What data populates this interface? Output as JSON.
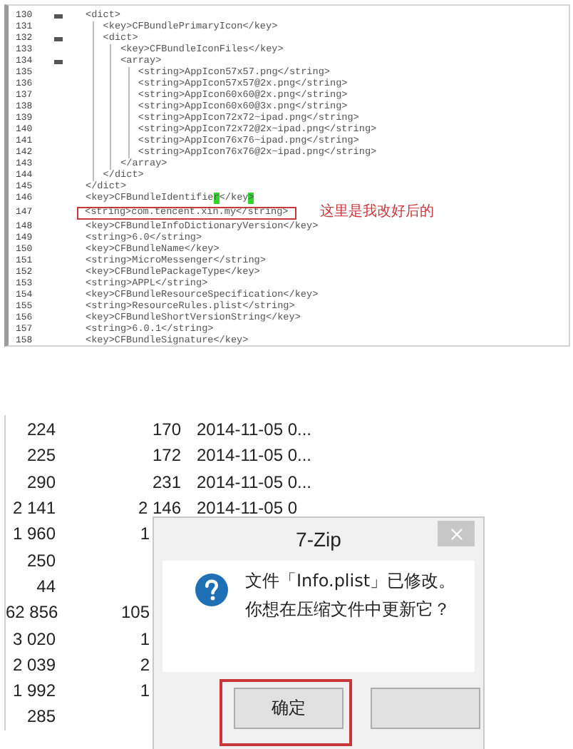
{
  "editor": {
    "lines": [
      {
        "number": "130",
        "fold": true,
        "code": "<dict>"
      },
      {
        "number": "131",
        "fold": false,
        "code": "   <key>CFBundlePrimaryIcon</key>"
      },
      {
        "number": "132",
        "fold": true,
        "code": "   <dict>"
      },
      {
        "number": "133",
        "fold": false,
        "code": "      <key>CFBundleIconFiles</key>"
      },
      {
        "number": "134",
        "fold": true,
        "code": "      <array>"
      },
      {
        "number": "135",
        "fold": false,
        "code": "         <string>AppIcon57x57.png</string>"
      },
      {
        "number": "136",
        "fold": false,
        "code": "         <string>AppIcon57x57@2x.png</string>"
      },
      {
        "number": "137",
        "fold": false,
        "code": "         <string>AppIcon60x60@2x.png</string>"
      },
      {
        "number": "138",
        "fold": false,
        "code": "         <string>AppIcon60x60@3x.png</string>"
      },
      {
        "number": "139",
        "fold": false,
        "code": "         <string>AppIcon72x72~ipad.png</string>"
      },
      {
        "number": "140",
        "fold": false,
        "code": "         <string>AppIcon72x72@2x~ipad.png</string>"
      },
      {
        "number": "141",
        "fold": false,
        "code": "         <string>AppIcon76x76~ipad.png</string>"
      },
      {
        "number": "142",
        "fold": false,
        "code": "         <string>AppIcon76x76@2x~ipad.png</string>"
      },
      {
        "number": "143",
        "fold": false,
        "code": "      </array>"
      },
      {
        "number": "144",
        "fold": false,
        "code": "   </dict>"
      },
      {
        "number": "145",
        "fold": false,
        "code": "</dict>"
      },
      {
        "number": "146",
        "fold": false,
        "parts": [
          {
            "text": "<key>CFBundleIdentifie",
            "match": false
          },
          {
            "text": "r",
            "match": true
          },
          {
            "text": "</key",
            "match": false
          },
          {
            "text": ">",
            "match": true
          }
        ]
      },
      {
        "number": "147",
        "fold": false,
        "code": "<string>com.tencent.xin.my</string>",
        "boxed": true,
        "note": "这里是我改好后的"
      },
      {
        "number": "148",
        "fold": false,
        "code": "<key>CFBundleInfoDictionaryVersion</key>"
      },
      {
        "number": "149",
        "fold": false,
        "code": "<string>6.0</string>"
      },
      {
        "number": "150",
        "fold": false,
        "code": "<key>CFBundleName</key>"
      },
      {
        "number": "151",
        "fold": false,
        "code": "<string>MicroMessenger</string>"
      },
      {
        "number": "152",
        "fold": false,
        "code": "<key>CFBundlePackageType</key>"
      },
      {
        "number": "153",
        "fold": false,
        "code": "<string>APPL</string>"
      },
      {
        "number": "154",
        "fold": false,
        "code": "<key>CFBundleResourceSpecification</key>"
      },
      {
        "number": "155",
        "fold": false,
        "code": "<string>ResourceRules.plist</string>"
      },
      {
        "number": "156",
        "fold": false,
        "code": "<key>CFBundleShortVersionString</key>"
      },
      {
        "number": "157",
        "fold": false,
        "code": "<string>6.0.1</string>"
      },
      {
        "number": "158",
        "fold": false,
        "code": "<key>CFBundleSignature</key>"
      }
    ]
  },
  "file_list": {
    "rows": [
      {
        "size": "224",
        "packed": "170",
        "modified": "2014-11-05 0...",
        "covered": false
      },
      {
        "size": "225",
        "packed": "172",
        "modified": "2014-11-05 0...",
        "covered": false
      },
      {
        "size": "290",
        "packed": "231",
        "modified": "2014-11-05 0...",
        "covered": false
      },
      {
        "size": "2 141",
        "packed": "2 146",
        "modified": "2014-11-05 0",
        "covered": false
      },
      {
        "size": "1 960",
        "packed": "1",
        "covered": true
      },
      {
        "size": "250"
      },
      {
        "size": "44"
      },
      {
        "size": "62 856",
        "packed": "105",
        "covered": true
      },
      {
        "size": "3 020",
        "packed": "1",
        "covered": true
      },
      {
        "size": "2 039",
        "packed": "2",
        "covered": true
      },
      {
        "size": "1 992",
        "packed": "1",
        "covered": true
      },
      {
        "size": "285"
      }
    ]
  },
  "dialog": {
    "title": "7-Zip",
    "message_lines": [
      "文件「Info.plist」已修改。",
      "你想在压缩文件中更新它？"
    ],
    "buttons": [
      {
        "label": "确定",
        "boxed": true
      },
      {
        "boxed": false
      }
    ]
  }
}
